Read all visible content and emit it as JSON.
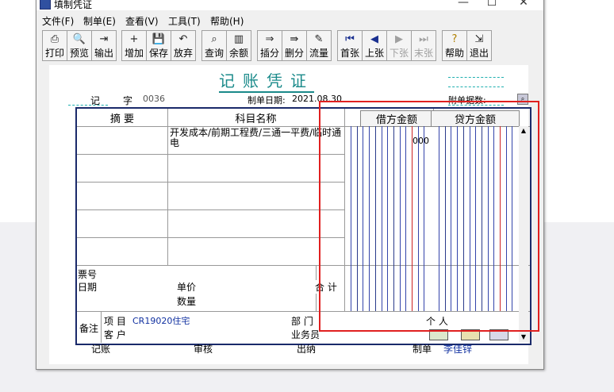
{
  "window": {
    "title": "填制凭证",
    "min": "—",
    "max": "☐",
    "close": "✕"
  },
  "menu": [
    "文件(F)",
    "制单(E)",
    "查看(V)",
    "工具(T)",
    "帮助(H)"
  ],
  "toolbar": [
    {
      "label": "打印",
      "icon": "printer-icon",
      "glyph": "⎙"
    },
    {
      "label": "预览",
      "icon": "preview-icon",
      "glyph": "🔍"
    },
    {
      "label": "输出",
      "icon": "export-icon",
      "glyph": "⇥"
    },
    {
      "label": "增加",
      "icon": "add-icon",
      "glyph": "+"
    },
    {
      "label": "保存",
      "icon": "save-icon",
      "glyph": "💾"
    },
    {
      "label": "放弃",
      "icon": "undo-icon",
      "glyph": "↶"
    },
    {
      "label": "查询",
      "icon": "binoculars-icon",
      "glyph": "⌕"
    },
    {
      "label": "余额",
      "icon": "balance-chart-icon",
      "glyph": "▥"
    },
    {
      "label": "插分",
      "icon": "insert-line-icon",
      "glyph": "⇒"
    },
    {
      "label": "删分",
      "icon": "delete-line-icon",
      "glyph": "⇛"
    },
    {
      "label": "流量",
      "icon": "flow-icon",
      "glyph": "✎"
    },
    {
      "label": "首张",
      "icon": "first-icon",
      "glyph": "⏮"
    },
    {
      "label": "上张",
      "icon": "prev-icon",
      "glyph": "◀"
    },
    {
      "label": "下张",
      "icon": "next-icon",
      "glyph": "▶"
    },
    {
      "label": "末张",
      "icon": "last-icon",
      "glyph": "⏭"
    },
    {
      "label": "帮助",
      "icon": "help-icon",
      "glyph": "?"
    },
    {
      "label": "退出",
      "icon": "exit-icon",
      "glyph": "⇲"
    }
  ],
  "voucher": {
    "title": "记账凭证",
    "type_label": "记",
    "zi_label": "字",
    "number": "0036",
    "date_label": "制单日期:",
    "date": "2021.08.30",
    "attach_label": "附单据数:",
    "headers": {
      "summary": "摘 要",
      "account": "科目名称",
      "debit": "借方金额",
      "credit": "贷方金额"
    },
    "rows": [
      {
        "summary": "",
        "account": "开发成本/前期工程费/三通一平费/临时通电",
        "debit": "000",
        "credit": ""
      }
    ],
    "bill_no_label": "票号",
    "bill_date_label": "日期",
    "unit_price_label": "单价",
    "quantity_label": "数量",
    "total_label": "合 计",
    "notes_label": "备注",
    "project_label": "项  目",
    "project_value": "CR19020住宅",
    "dept_label": "部  门",
    "person_label": "个  人",
    "customer_label": "客  户",
    "salesman_label": "业务员",
    "footer": {
      "bookkeeping": "记账",
      "review": "审核",
      "cashier": "出纳",
      "maker_label": "制单",
      "maker_name": "李佳锌"
    }
  }
}
